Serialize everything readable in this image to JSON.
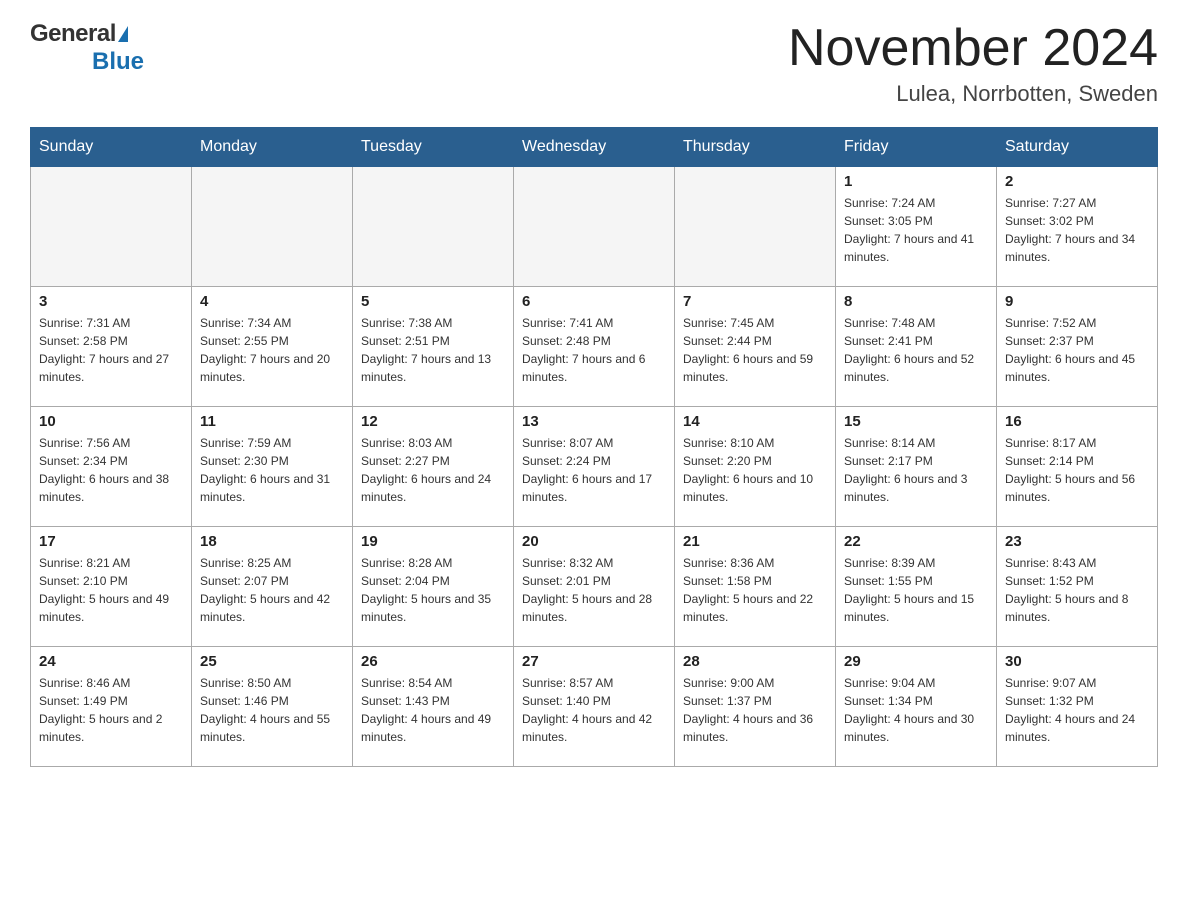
{
  "header": {
    "logo_general": "General",
    "logo_blue": "Blue",
    "month_title": "November 2024",
    "location": "Lulea, Norrbotten, Sweden"
  },
  "days_of_week": [
    "Sunday",
    "Monday",
    "Tuesday",
    "Wednesday",
    "Thursday",
    "Friday",
    "Saturday"
  ],
  "weeks": [
    [
      {
        "day": "",
        "info": ""
      },
      {
        "day": "",
        "info": ""
      },
      {
        "day": "",
        "info": ""
      },
      {
        "day": "",
        "info": ""
      },
      {
        "day": "",
        "info": ""
      },
      {
        "day": "1",
        "info": "Sunrise: 7:24 AM\nSunset: 3:05 PM\nDaylight: 7 hours and 41 minutes."
      },
      {
        "day": "2",
        "info": "Sunrise: 7:27 AM\nSunset: 3:02 PM\nDaylight: 7 hours and 34 minutes."
      }
    ],
    [
      {
        "day": "3",
        "info": "Sunrise: 7:31 AM\nSunset: 2:58 PM\nDaylight: 7 hours and 27 minutes."
      },
      {
        "day": "4",
        "info": "Sunrise: 7:34 AM\nSunset: 2:55 PM\nDaylight: 7 hours and 20 minutes."
      },
      {
        "day": "5",
        "info": "Sunrise: 7:38 AM\nSunset: 2:51 PM\nDaylight: 7 hours and 13 minutes."
      },
      {
        "day": "6",
        "info": "Sunrise: 7:41 AM\nSunset: 2:48 PM\nDaylight: 7 hours and 6 minutes."
      },
      {
        "day": "7",
        "info": "Sunrise: 7:45 AM\nSunset: 2:44 PM\nDaylight: 6 hours and 59 minutes."
      },
      {
        "day": "8",
        "info": "Sunrise: 7:48 AM\nSunset: 2:41 PM\nDaylight: 6 hours and 52 minutes."
      },
      {
        "day": "9",
        "info": "Sunrise: 7:52 AM\nSunset: 2:37 PM\nDaylight: 6 hours and 45 minutes."
      }
    ],
    [
      {
        "day": "10",
        "info": "Sunrise: 7:56 AM\nSunset: 2:34 PM\nDaylight: 6 hours and 38 minutes."
      },
      {
        "day": "11",
        "info": "Sunrise: 7:59 AM\nSunset: 2:30 PM\nDaylight: 6 hours and 31 minutes."
      },
      {
        "day": "12",
        "info": "Sunrise: 8:03 AM\nSunset: 2:27 PM\nDaylight: 6 hours and 24 minutes."
      },
      {
        "day": "13",
        "info": "Sunrise: 8:07 AM\nSunset: 2:24 PM\nDaylight: 6 hours and 17 minutes."
      },
      {
        "day": "14",
        "info": "Sunrise: 8:10 AM\nSunset: 2:20 PM\nDaylight: 6 hours and 10 minutes."
      },
      {
        "day": "15",
        "info": "Sunrise: 8:14 AM\nSunset: 2:17 PM\nDaylight: 6 hours and 3 minutes."
      },
      {
        "day": "16",
        "info": "Sunrise: 8:17 AM\nSunset: 2:14 PM\nDaylight: 5 hours and 56 minutes."
      }
    ],
    [
      {
        "day": "17",
        "info": "Sunrise: 8:21 AM\nSunset: 2:10 PM\nDaylight: 5 hours and 49 minutes."
      },
      {
        "day": "18",
        "info": "Sunrise: 8:25 AM\nSunset: 2:07 PM\nDaylight: 5 hours and 42 minutes."
      },
      {
        "day": "19",
        "info": "Sunrise: 8:28 AM\nSunset: 2:04 PM\nDaylight: 5 hours and 35 minutes."
      },
      {
        "day": "20",
        "info": "Sunrise: 8:32 AM\nSunset: 2:01 PM\nDaylight: 5 hours and 28 minutes."
      },
      {
        "day": "21",
        "info": "Sunrise: 8:36 AM\nSunset: 1:58 PM\nDaylight: 5 hours and 22 minutes."
      },
      {
        "day": "22",
        "info": "Sunrise: 8:39 AM\nSunset: 1:55 PM\nDaylight: 5 hours and 15 minutes."
      },
      {
        "day": "23",
        "info": "Sunrise: 8:43 AM\nSunset: 1:52 PM\nDaylight: 5 hours and 8 minutes."
      }
    ],
    [
      {
        "day": "24",
        "info": "Sunrise: 8:46 AM\nSunset: 1:49 PM\nDaylight: 5 hours and 2 minutes."
      },
      {
        "day": "25",
        "info": "Sunrise: 8:50 AM\nSunset: 1:46 PM\nDaylight: 4 hours and 55 minutes."
      },
      {
        "day": "26",
        "info": "Sunrise: 8:54 AM\nSunset: 1:43 PM\nDaylight: 4 hours and 49 minutes."
      },
      {
        "day": "27",
        "info": "Sunrise: 8:57 AM\nSunset: 1:40 PM\nDaylight: 4 hours and 42 minutes."
      },
      {
        "day": "28",
        "info": "Sunrise: 9:00 AM\nSunset: 1:37 PM\nDaylight: 4 hours and 36 minutes."
      },
      {
        "day": "29",
        "info": "Sunrise: 9:04 AM\nSunset: 1:34 PM\nDaylight: 4 hours and 30 minutes."
      },
      {
        "day": "30",
        "info": "Sunrise: 9:07 AM\nSunset: 1:32 PM\nDaylight: 4 hours and 24 minutes."
      }
    ]
  ]
}
